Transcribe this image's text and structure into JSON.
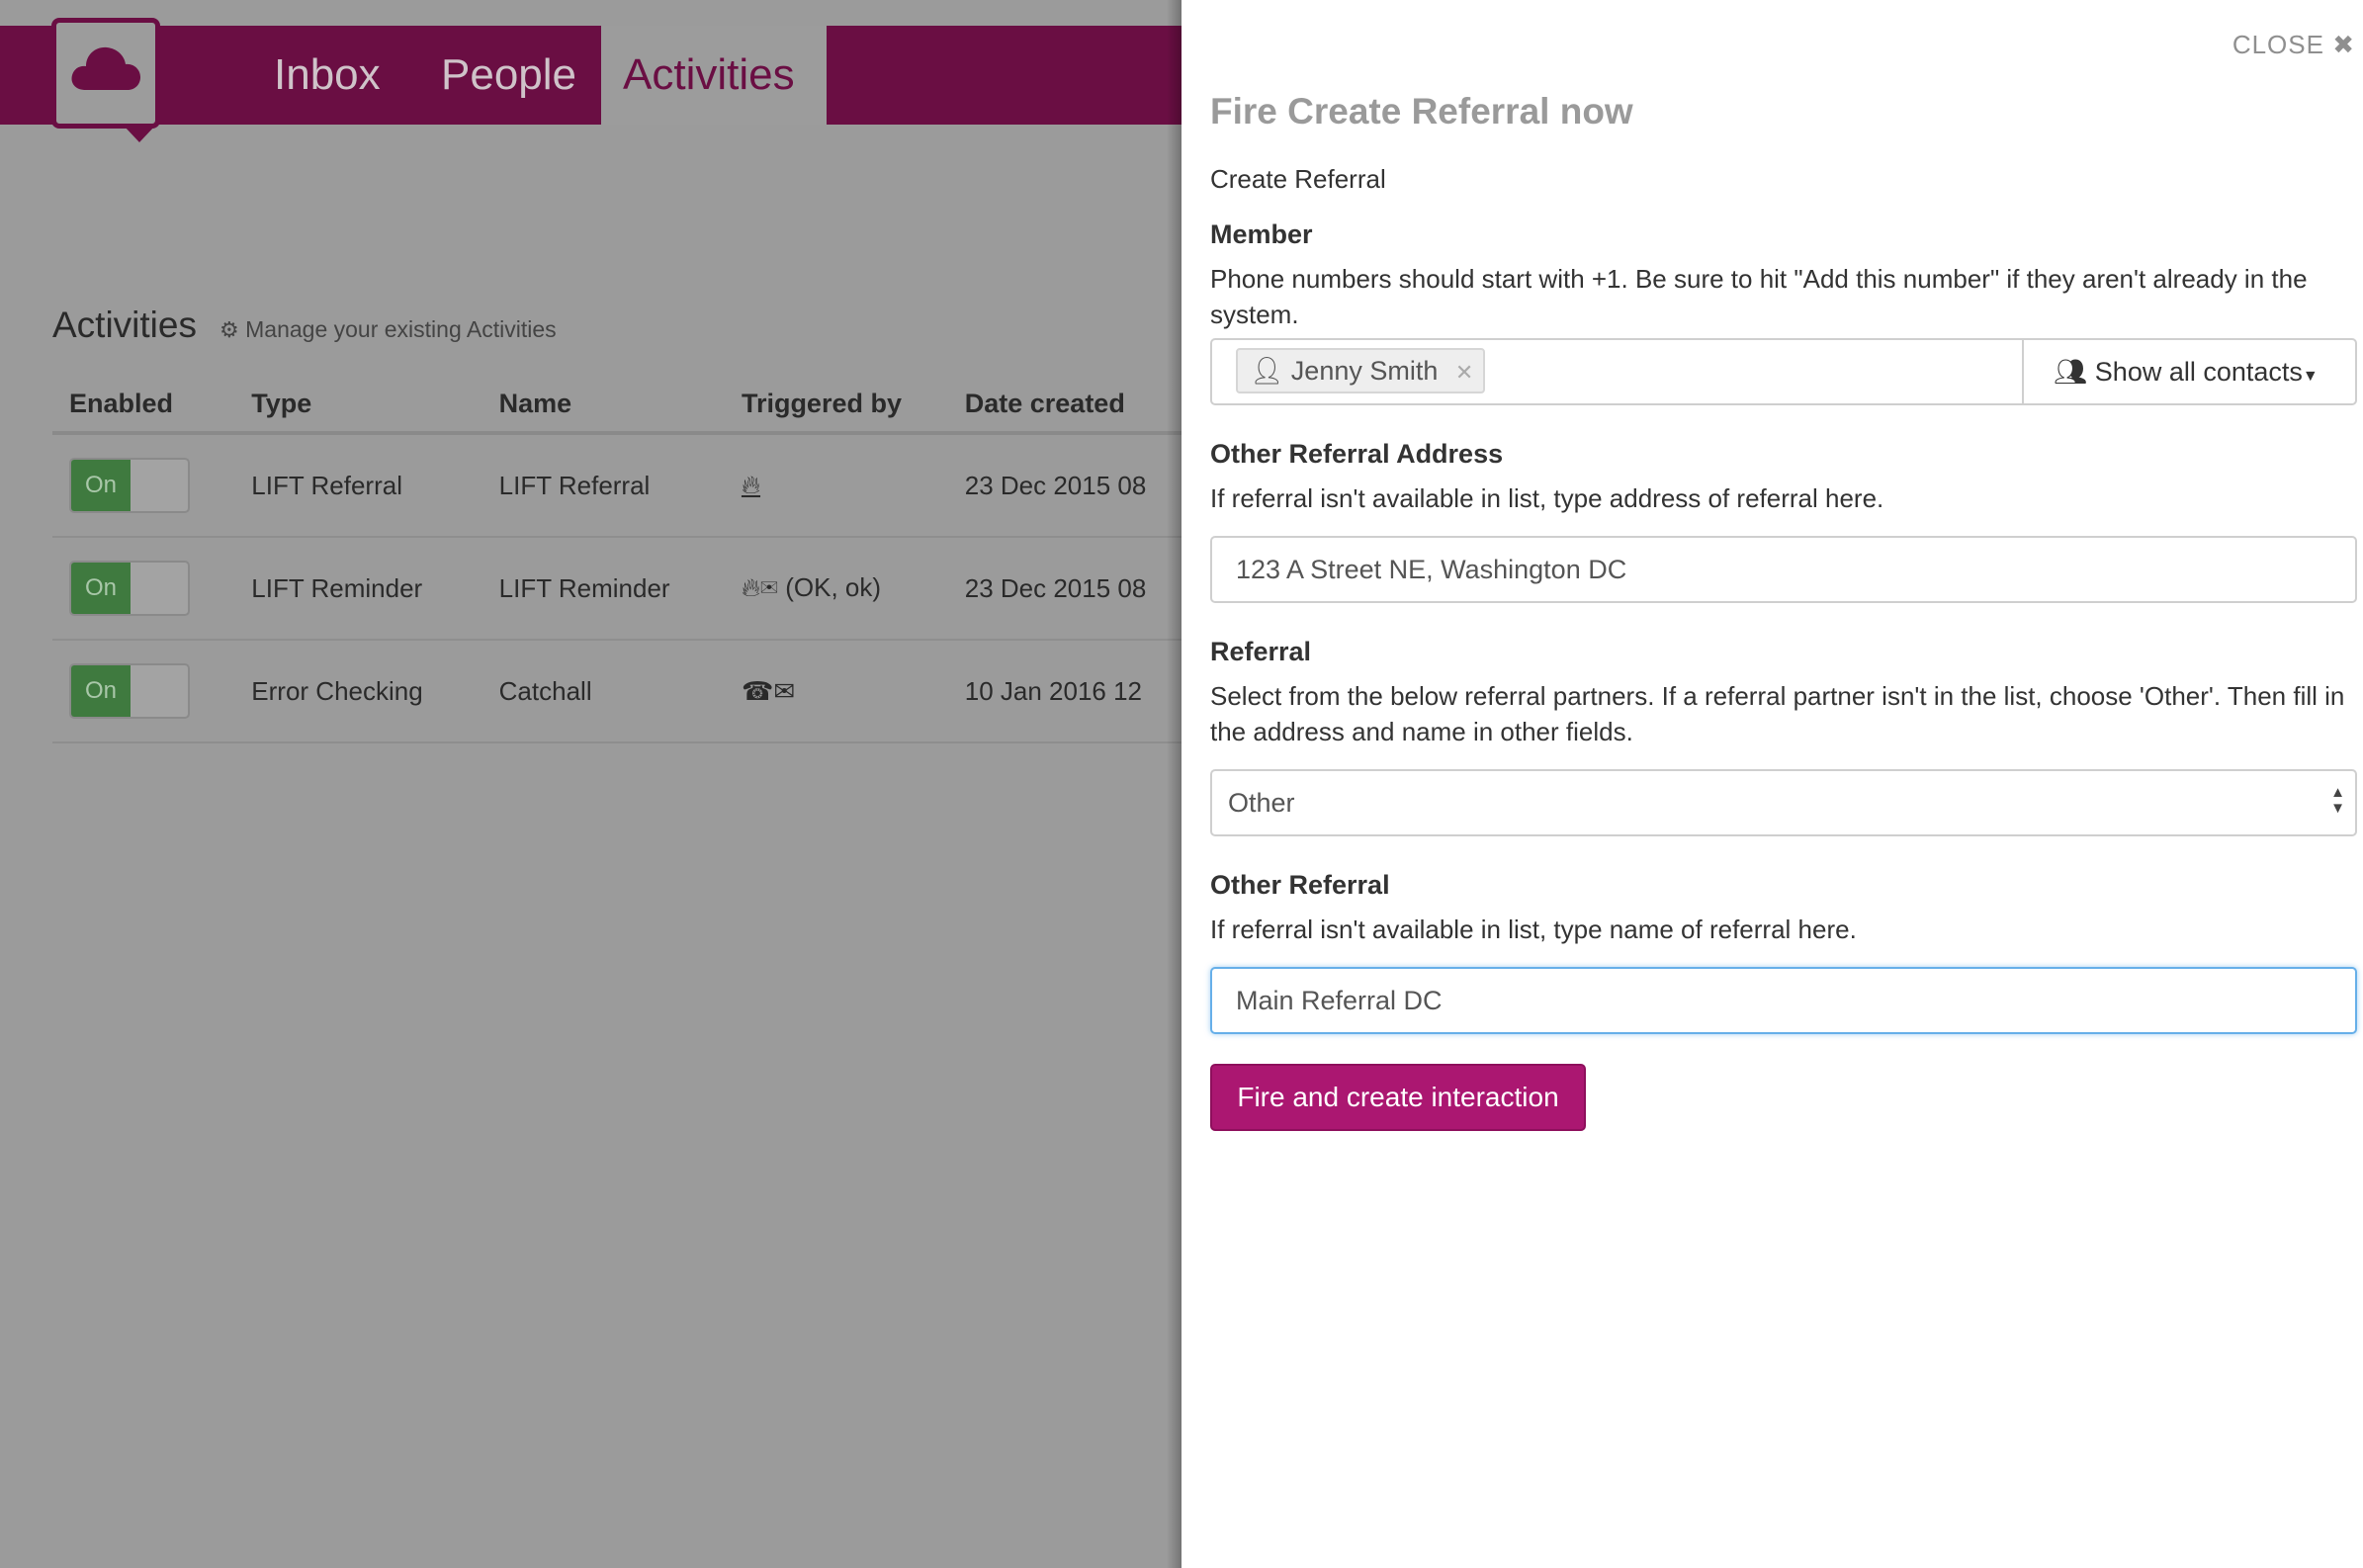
{
  "nav": {
    "items": [
      "Inbox",
      "People",
      "Activities"
    ],
    "active": "Activities"
  },
  "activities_page": {
    "title": "Activities",
    "subtitle": "Manage your existing Activities",
    "columns": [
      "Enabled",
      "Type",
      "Name",
      "Triggered by",
      "Date created"
    ],
    "rows": [
      {
        "enabled": "On",
        "type": "LIFT Referral",
        "name": "LIFT Referral",
        "trigger_icons": [
          "fire-icon"
        ],
        "trigger_text": "",
        "date": "23 Dec 2015 08"
      },
      {
        "enabled": "On",
        "type": "LIFT Reminder",
        "name": "LIFT Reminder",
        "trigger_icons": [
          "fire-icon",
          "envelope-icon"
        ],
        "trigger_text": "(OK, ok)",
        "date": "23 Dec 2015 08"
      },
      {
        "enabled": "On",
        "type": "Error Checking",
        "name": "Catchall",
        "trigger_icons": [
          "phone-icon",
          "envelope-icon"
        ],
        "trigger_text": "",
        "date": "10 Jan 2016 12"
      }
    ]
  },
  "panel": {
    "close_label": "CLOSE",
    "title": "Fire Create Referral now",
    "activity_name": "Create Referral",
    "member": {
      "label": "Member",
      "help": "Phone numbers should start with +1. Be sure to hit \"Add this number\" if they aren't already in the system.",
      "selected": "Jenny Smith",
      "show_contacts": "Show all contacts"
    },
    "other_address": {
      "label": "Other Referral Address",
      "help": "If referral isn't available in list, type address of referral here.",
      "value": "123 A Street NE, Washington DC"
    },
    "referral": {
      "label": "Referral",
      "help": "Select from the below referral partners. If a referral partner isn't in the list, choose 'Other'. Then fill in the address and name in other fields.",
      "selected": "Other"
    },
    "other_referral": {
      "label": "Other Referral",
      "help": "If referral isn't available in list, type name of referral here.",
      "value": "Main Referral DC"
    },
    "submit_label": "Fire and create interaction"
  },
  "colors": {
    "brand": "#6a0e43",
    "button": "#ab1771",
    "toggle_on": "#3f7a3f",
    "focus": "#66afe9"
  }
}
